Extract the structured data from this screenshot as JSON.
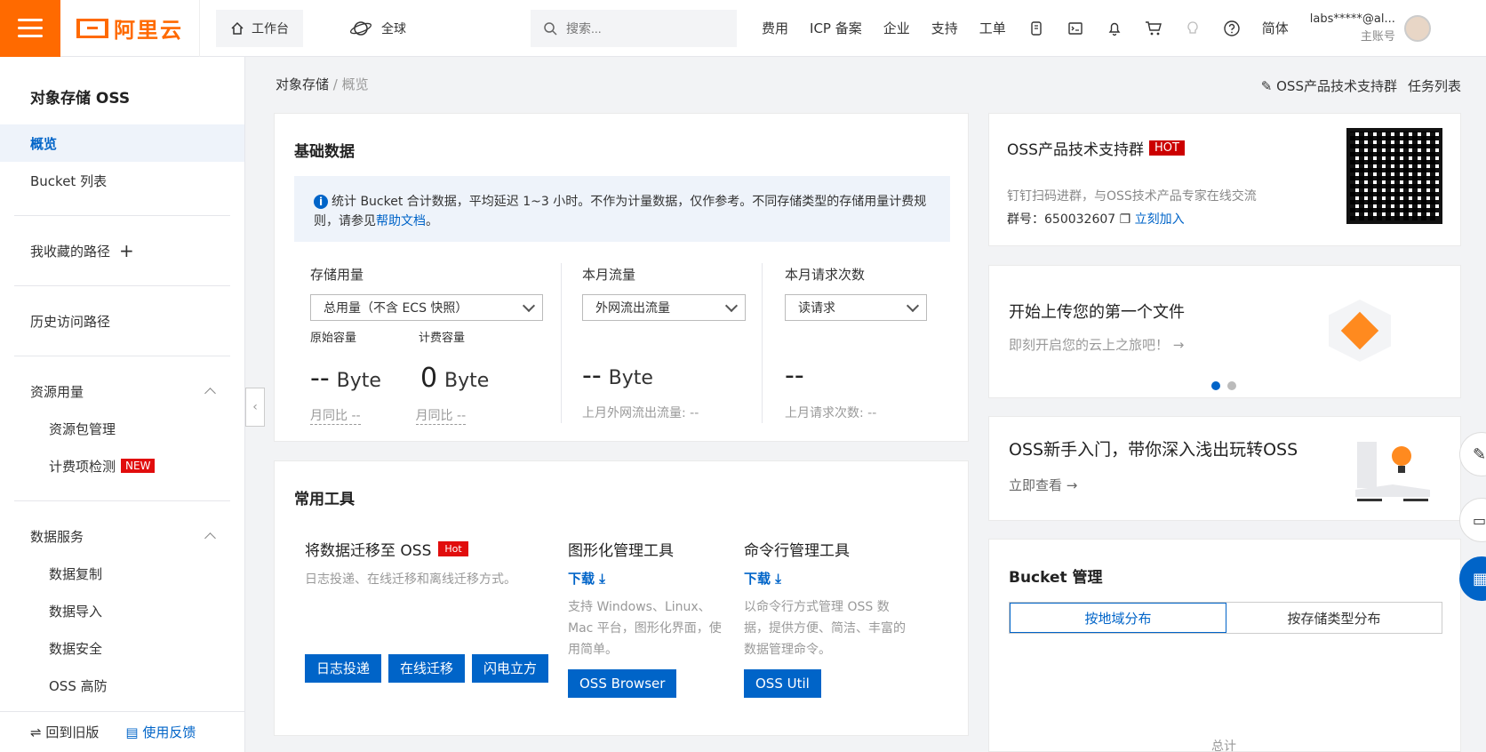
{
  "brand": {
    "logo_text": "阿里云",
    "accent": "#ff6a00",
    "primary": "#0064c8"
  },
  "topbar": {
    "workbench": "工作台",
    "region": "全球",
    "search_placeholder": "搜索...",
    "nav": [
      "费用",
      "ICP 备案",
      "企业",
      "支持",
      "工单"
    ],
    "lang": "简体",
    "account": "labs*****@al...",
    "account_role": "主账号"
  },
  "sidebar": {
    "title": "对象存储 OSS",
    "items": [
      "概览",
      "Bucket 列表"
    ],
    "favorites": "我收藏的路径",
    "history": "历史访问路径",
    "resource_group": "资源用量",
    "resource_items": [
      "资源包管理",
      "计费项检测"
    ],
    "new_tag": "NEW",
    "data_group": "数据服务",
    "data_items": [
      "数据复制",
      "数据导入",
      "数据安全",
      "OSS 高防"
    ],
    "footer_back": "回到旧版",
    "footer_feedback": "使用反馈"
  },
  "breadcrumb": {
    "root": "对象存储",
    "current": "概览"
  },
  "top_links": {
    "support": "OSS产品技术支持群",
    "tasks": "任务列表"
  },
  "basic": {
    "title": "基础数据",
    "notice_text": "统计 Bucket 合计数据，平均延迟 1~3 小时。不作为计量数据，仅作参考。不同存储类型的存储用量计费规则，请参见",
    "notice_link": "帮助文档",
    "notice_end": "。",
    "storage": {
      "label": "存储用量",
      "select": "总用量（不含 ECS 快照）",
      "raw_label": "原始容量",
      "billed_label": "计费容量",
      "raw_value": "--",
      "billed_value": "0",
      "unit": "Byte",
      "cmp": "月同比 --"
    },
    "traffic": {
      "label": "本月流量",
      "select": "外网流出流量",
      "value": "--",
      "unit": "Byte",
      "prev": "上月外网流出流量: --"
    },
    "requests": {
      "label": "本月请求次数",
      "select": "读请求",
      "value": "--",
      "prev": "上月请求次数:  --"
    }
  },
  "tools": {
    "title": "常用工具",
    "migrate": {
      "name": "将数据迁移至 OSS",
      "tag": "Hot",
      "desc": "日志投递、在线迁移和离线迁移方式。",
      "buttons": [
        "日志投递",
        "在线迁移",
        "闪电立方"
      ]
    },
    "gui": {
      "name": "图形化管理工具",
      "download": "下载",
      "desc": "支持 Windows、Linux、Mac 平台，图形化界面，使用简单。",
      "button": "OSS Browser"
    },
    "cli": {
      "name": "命令行管理工具",
      "download": "下载",
      "desc": "以命令行方式管理 OSS 数据，提供方便、简洁、丰富的数据管理命令。",
      "button": "OSS Util"
    }
  },
  "qr": {
    "title": "OSS产品技术支持群",
    "tag": "HOT",
    "desc": "钉钉扫码进群，与OSS技术产品专家在线交流",
    "group_no": "群号：650032607",
    "join": "立刻加入"
  },
  "upload": {
    "title": "开始上传您的第一个文件",
    "sub": "即刻开启您的云上之旅吧！ →"
  },
  "guide": {
    "title": "OSS新手入门，带你深入浅出玩转OSS",
    "sub": "立即查看 →"
  },
  "bucket": {
    "title": "Bucket 管理",
    "tabs": [
      "按地域分布",
      "按存储类型分布"
    ],
    "total": "总计"
  }
}
